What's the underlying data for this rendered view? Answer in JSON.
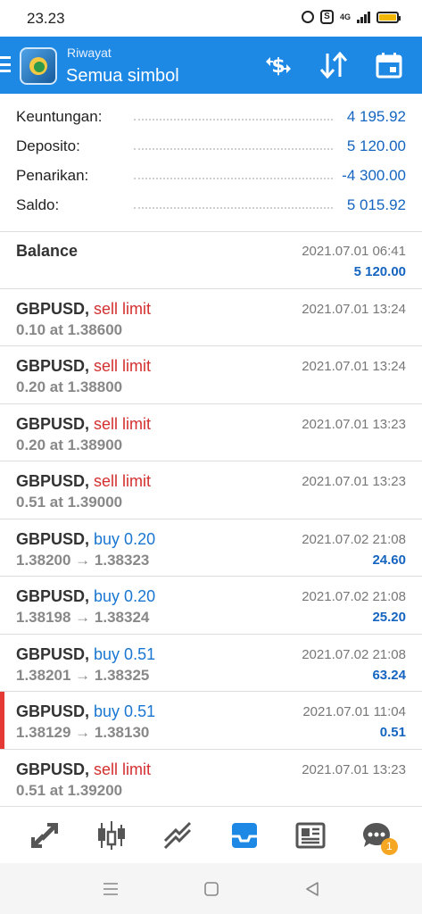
{
  "status_bar": {
    "time": "23.23",
    "network": "4G",
    "icons": [
      "alarm-icon",
      "s-app-icon",
      "signal-icon",
      "battery-icon"
    ]
  },
  "app_bar": {
    "subtitle": "Riwayat",
    "title": "Semua simbol",
    "actions": [
      "currency-exchange-icon",
      "sort-icon",
      "calendar-icon"
    ],
    "color": "#1e88e5"
  },
  "summary": [
    {
      "label": "Keuntungan:",
      "value": "4 195.92"
    },
    {
      "label": "Deposito:",
      "value": "5 120.00"
    },
    {
      "label": "Penarikan:",
      "value": "-4 300.00"
    },
    {
      "label": "Saldo:",
      "value": "5 015.92"
    }
  ],
  "history": [
    {
      "symbol": "Balance",
      "type": "",
      "sub": "",
      "date": "2021.07.01 06:41",
      "profit": "5 120.00"
    },
    {
      "symbol": "GBPUSD,",
      "type": "sell limit",
      "sub": "0.10 at 1.38600",
      "date": "2021.07.01 13:24",
      "profit": ""
    },
    {
      "symbol": "GBPUSD,",
      "type": "sell limit",
      "sub": "0.20 at 1.38800",
      "date": "2021.07.01 13:24",
      "profit": ""
    },
    {
      "symbol": "GBPUSD,",
      "type": "sell limit",
      "sub": "0.20 at 1.38900",
      "date": "2021.07.01 13:23",
      "profit": ""
    },
    {
      "symbol": "GBPUSD,",
      "type": "sell limit",
      "sub": "0.51 at 1.39000",
      "date": "2021.07.01 13:23",
      "profit": ""
    },
    {
      "symbol": "GBPUSD,",
      "type": "buy 0.20",
      "sub": "1.38200 → 1.38323",
      "date": "2021.07.02 21:08",
      "profit": "24.60"
    },
    {
      "symbol": "GBPUSD,",
      "type": "buy 0.20",
      "sub": "1.38198 → 1.38324",
      "date": "2021.07.02 21:08",
      "profit": "25.20"
    },
    {
      "symbol": "GBPUSD,",
      "type": "buy 0.51",
      "sub": "1.38201 → 1.38325",
      "date": "2021.07.02 21:08",
      "profit": "63.24"
    },
    {
      "symbol": "GBPUSD,",
      "type": "buy 0.51",
      "sub": "1.38129 → 1.38130",
      "date": "2021.07.01 11:04",
      "profit": "0.51"
    },
    {
      "symbol": "GBPUSD,",
      "type": "sell limit",
      "sub": "0.51 at 1.39200",
      "date": "2021.07.01 13:23",
      "profit": ""
    }
  ],
  "bottom_nav": {
    "items": [
      "quotes-icon",
      "chart-icon",
      "trade-icon",
      "history-icon",
      "news-icon",
      "chat-icon"
    ],
    "active": "history-icon",
    "chat_badge": "1"
  },
  "system_nav": [
    "menu-icon",
    "home-icon",
    "back-icon"
  ],
  "colors": {
    "accent": "#1e88e5",
    "sell": "#d32f2f",
    "buy": "#1976d2",
    "profit": "#1565c0",
    "badge": "#f5a623"
  }
}
